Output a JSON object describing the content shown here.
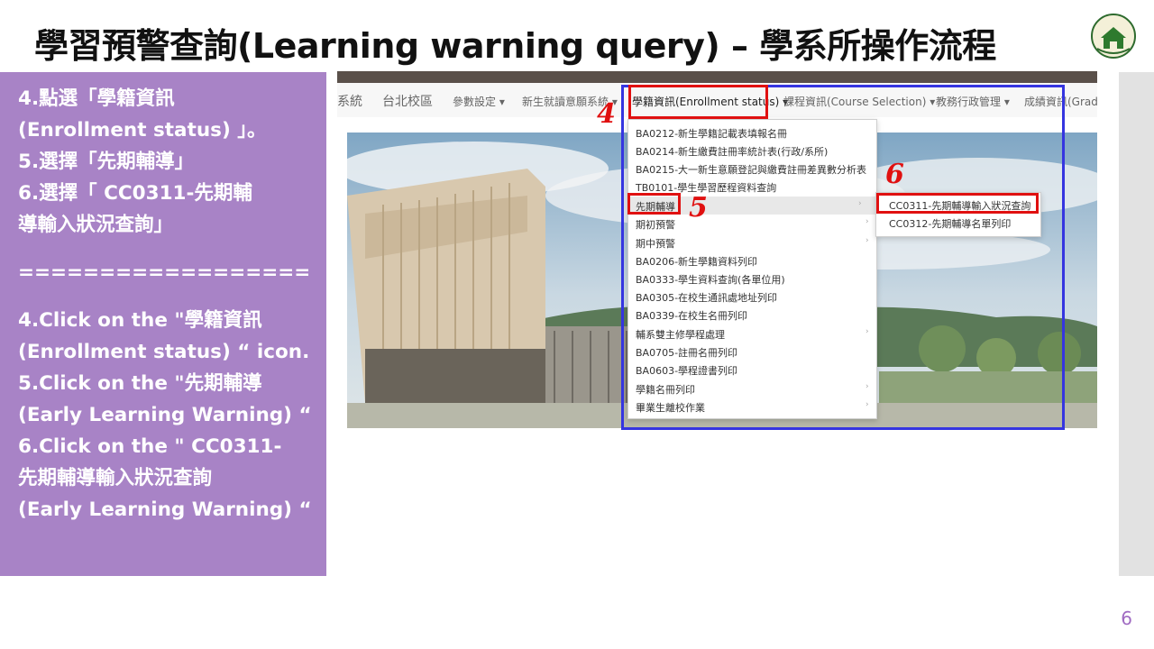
{
  "title": "學習預警查詢(Learning warning query) – 學系所操作流程",
  "page_number": "6",
  "instructions": {
    "zh": [
      "4.點選「學籍資訊",
      "(Enrollment status) 」。",
      "5.選擇「先期輔導」",
      "6.選擇「 CC0311-先期輔",
      "導輸入狀況查詢」"
    ],
    "divider": "==================",
    "en": [
      "4.Click on the \"學籍資訊",
      "(Enrollment status) “ icon.",
      "5.Click on the \"先期輔導",
      "(Early Learning Warning) “",
      "6.Click on the \" CC0311-",
      "先期輔導輸入狀況查詢",
      "(Early Learning Warning) “"
    ]
  },
  "nav": {
    "items": [
      "系統",
      "台北校區",
      "參數設定 ▾",
      "新生就讀意願系統 ▾",
      "學籍資訊(Enrollment status) ▾",
      "課程資訊(Course Selection) ▾",
      "教務行政管理 ▾",
      "成績資訊(Grading"
    ]
  },
  "menu": {
    "items": [
      "BA0212-新生學籍記載表填報名冊",
      "BA0214-新生繳費註冊率統計表(行政/系所)",
      "BA0215-大一新生意願登記與繳費註冊差異數分析表",
      "TB0101-學生學習歷程資料查詢",
      "先期輔導",
      "期初預警",
      "期中預警",
      "BA0206-新生學籍資料列印",
      "BA0333-學生資料查詢(各單位用)",
      "BA0305-在校生通訊處地址列印",
      "BA0339-在校生名冊列印",
      "輔系雙主修學程處理",
      "BA0705-註冊名冊列印",
      "BA0603-學程證書列印",
      "學籍名冊列印",
      "畢業生離校作業"
    ],
    "arrow": "›"
  },
  "submenu": {
    "items": [
      "CC0311-先期輔導輸入狀況查詢",
      "CC0312-先期輔導名單列印"
    ]
  },
  "steps": [
    "4",
    "5",
    "6"
  ],
  "colors": {
    "panel": "#a883c6",
    "highlight_red": "#e01010",
    "highlight_blue": "#3535e0",
    "page_number": "#a06bc2"
  }
}
